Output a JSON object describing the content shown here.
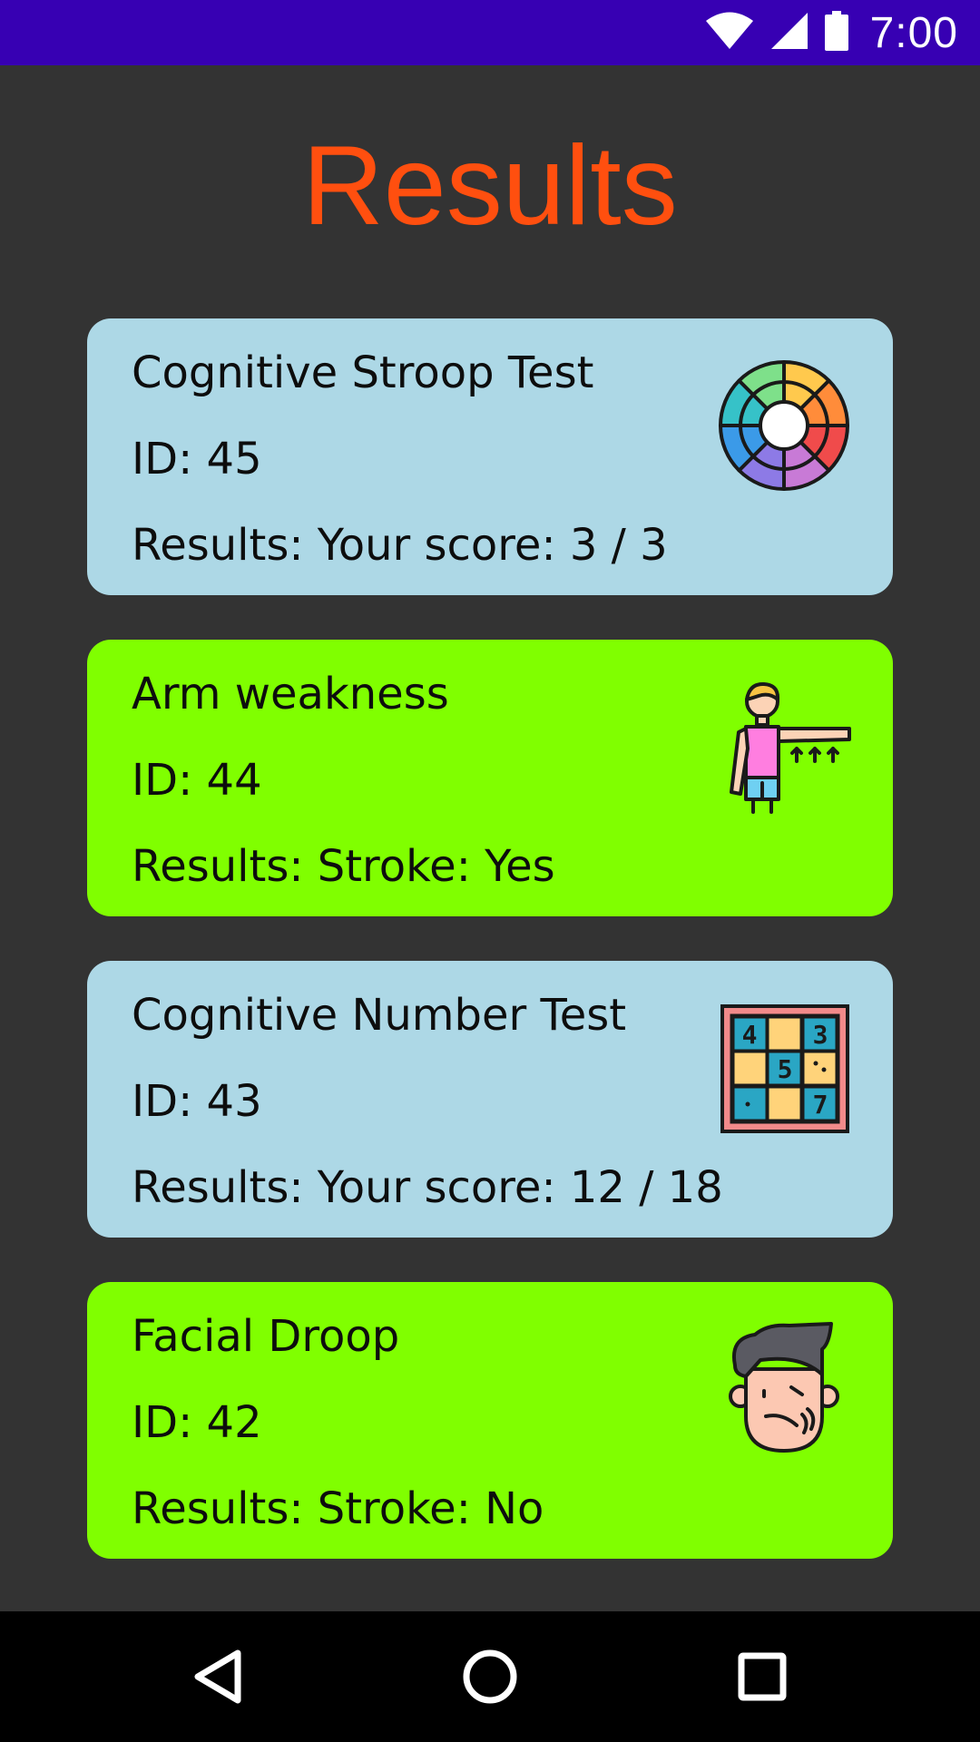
{
  "status_bar": {
    "time": "7:00",
    "icons": [
      "wifi-icon",
      "signal-icon",
      "battery-icon"
    ]
  },
  "title": "Results",
  "colors": {
    "status_bar": "#3700b3",
    "background": "#333333",
    "title": "#ff4f0f",
    "card_blue": "#add8e6",
    "card_green": "#80ff00"
  },
  "cards": [
    {
      "name": "Cognitive Stroop Test",
      "id": "ID: 45",
      "result": "Results: Your score: 3 / 3",
      "icon": "color-wheel-icon",
      "color": "blue"
    },
    {
      "name": "Arm weakness",
      "id": "ID: 44",
      "result": "Results: Stroke: Yes",
      "icon": "arm-raise-icon",
      "color": "green"
    },
    {
      "name": "Cognitive Number Test",
      "id": "ID: 43",
      "result": "Results: Your score: 12 / 18",
      "icon": "number-grid-icon",
      "color": "blue"
    },
    {
      "name": "Facial Droop",
      "id": "ID: 42",
      "result": "Results: Stroke: No",
      "icon": "droopy-face-icon",
      "color": "green"
    }
  ],
  "nav_bar": {
    "buttons": [
      "back-icon",
      "home-icon",
      "recents-icon"
    ]
  }
}
